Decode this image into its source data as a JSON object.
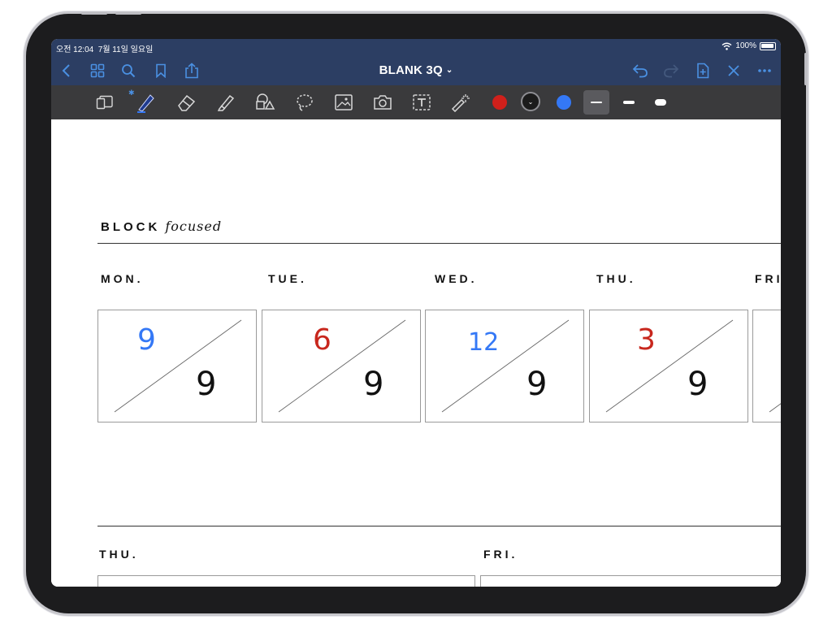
{
  "status": {
    "time": "오전 12:04",
    "date": "7월 11일 일요일",
    "battery": "100%"
  },
  "nav": {
    "title": "BLANK 3Q",
    "left_icons": [
      "back-icon",
      "grid-icon",
      "search-icon",
      "bookmark-icon",
      "share-icon"
    ],
    "right_icons": [
      "undo-icon",
      "redo-icon",
      "add-page-icon",
      "close-icon",
      "more-icon"
    ]
  },
  "toolbar": {
    "tools": [
      "page-view-icon",
      "pen-icon",
      "eraser-icon",
      "highlighter-icon",
      "shapes-icon",
      "lasso-icon",
      "image-icon",
      "camera-icon",
      "text-icon",
      "laser-pointer-icon"
    ],
    "colors": {
      "red": "#d0201b",
      "black": "#1b1b1b",
      "blue": "#3478f6"
    },
    "selected_color": "black",
    "thicknesses": [
      "thin",
      "medium",
      "thick"
    ],
    "selected_thickness": "thin"
  },
  "page": {
    "heading": "BLOCK",
    "heading_script": "focused",
    "days": [
      "MON.",
      "TUE.",
      "WED.",
      "THU.",
      "FRI."
    ],
    "boxes": [
      {
        "top": "9",
        "top_color": "#3478f6",
        "bottom": "9"
      },
      {
        "top": "6",
        "top_color": "#c8271d",
        "bottom": "9"
      },
      {
        "top": "12",
        "top_color": "#3478f6",
        "bottom": "9"
      },
      {
        "top": "3",
        "top_color": "#c8271d",
        "bottom": "9"
      }
    ],
    "bottom_days": [
      "THU.",
      "FRI."
    ]
  }
}
